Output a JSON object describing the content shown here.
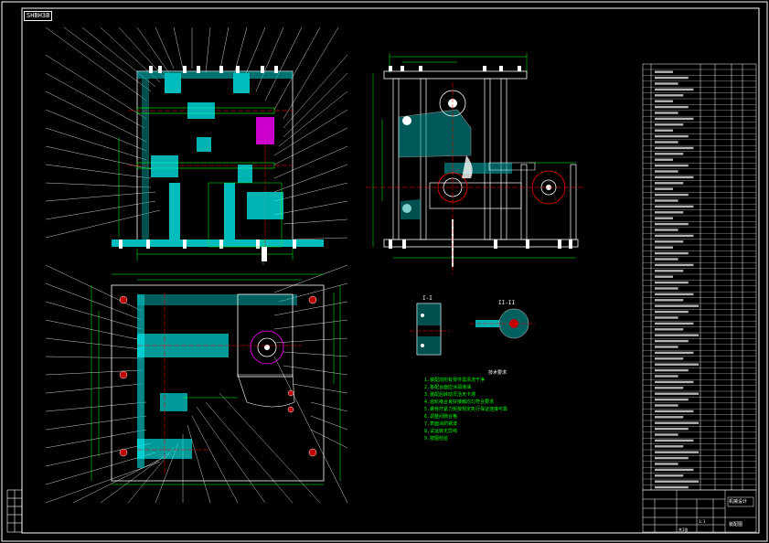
{
  "drawing": {
    "stamp_text": "SHBH3B",
    "section_a_label": "I-I",
    "section_b_label": "II-II",
    "notes_title": "技术要求",
    "notes": [
      "1.装配前所有零件需清洗干净",
      "2.各配合面应涂润滑油",
      "3.装配后转动灵活无卡滞",
      "4.齿轮啮合良好接触均匀符合要求",
      "5.螺栓拧紧力矩按规定执行保证连接可靠",
      "6.调整间隙合格",
      "7.表面涂防锈漆",
      "8.试运转无异响",
      "9.按图检验"
    ],
    "colors": {
      "outline": "#ffffff",
      "part": "#00ffff",
      "dimension": "#00ff00",
      "centerline": "#ff0000",
      "highlight": "#ff00ff",
      "hatch": "#00ffff"
    }
  },
  "title_block": {
    "company": "机械设计",
    "drawing_name": "装配图",
    "scale": "1:1",
    "sheet": "共1张"
  }
}
